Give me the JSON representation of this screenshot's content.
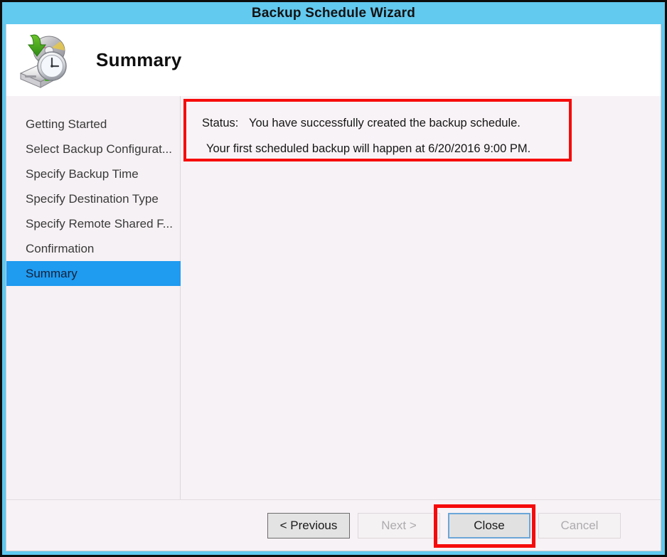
{
  "window": {
    "title": "Backup Schedule Wizard",
    "frame_color": "#62c9ef"
  },
  "header": {
    "title": "Summary",
    "icon": "backup-schedule-icon"
  },
  "sidebar": {
    "items": [
      {
        "label": "Getting Started",
        "selected": false
      },
      {
        "label": "Select Backup Configurat...",
        "selected": false
      },
      {
        "label": "Specify Backup Time",
        "selected": false
      },
      {
        "label": "Specify Destination Type",
        "selected": false
      },
      {
        "label": "Specify Remote Shared F...",
        "selected": false
      },
      {
        "label": "Confirmation",
        "selected": false
      },
      {
        "label": "Summary",
        "selected": true
      }
    ],
    "selected_color": "#1f9bf0"
  },
  "status": {
    "label": "Status:",
    "message": "You have successfully created the backup schedule.",
    "detail": "Your first scheduled backup will happen at 6/20/2016 9:00 PM.",
    "highlight_color": "#f60b0b"
  },
  "buttons": {
    "previous": "< Previous",
    "next": "Next >",
    "close": "Close",
    "cancel": "Cancel"
  }
}
